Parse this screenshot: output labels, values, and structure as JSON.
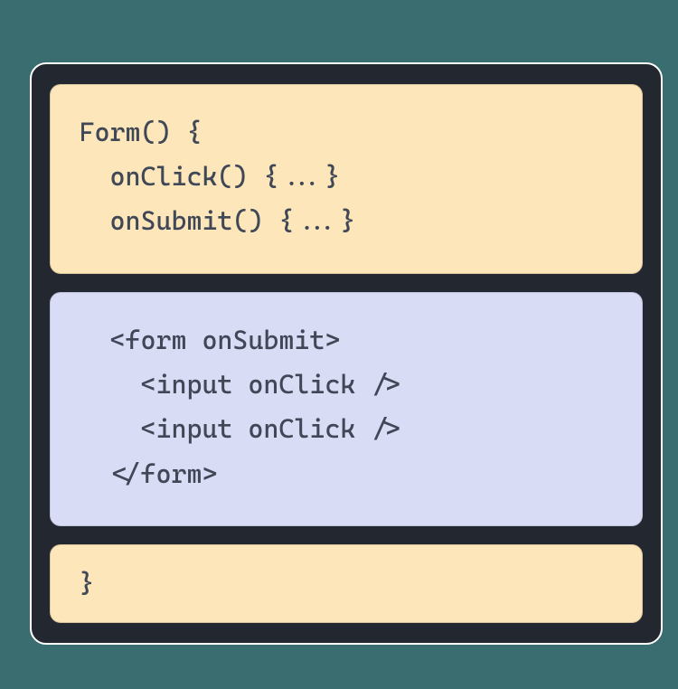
{
  "blocks": {
    "top": "Form() {\n  onClick() {...}\n  onSubmit() {...}",
    "mid": "  <form onSubmit>\n    <input onClick />\n    <input onClick />\n  </form>",
    "bot": "}"
  },
  "colors": {
    "canvas": "#3a6d6f",
    "frame": "#23272f",
    "jsBlock": "#fde7ba",
    "jsxBlock": "#d9dcf5",
    "text": "#404756",
    "frameBorder": "#ffffff"
  }
}
